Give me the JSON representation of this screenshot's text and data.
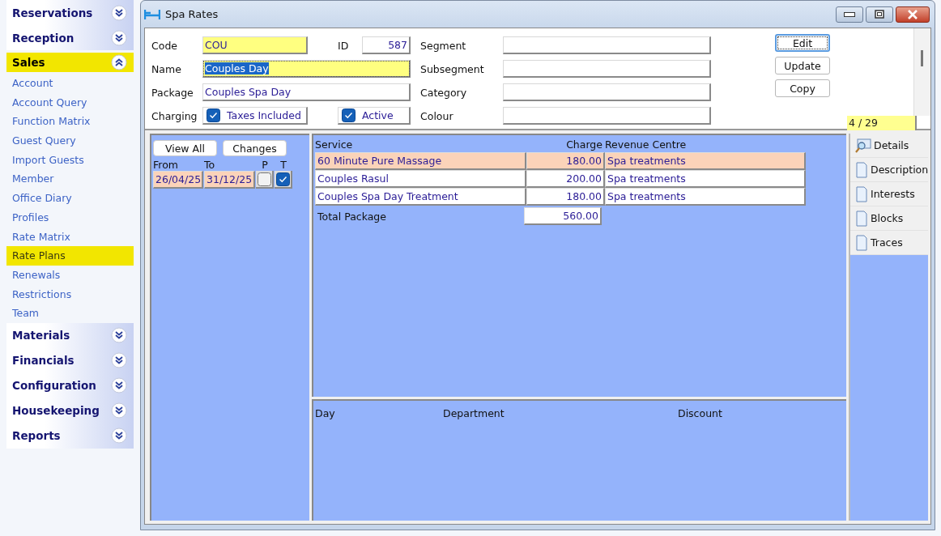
{
  "sidebar": {
    "sections": [
      {
        "label": "Reservations",
        "expanded": false,
        "selected": false
      },
      {
        "label": "Reception",
        "expanded": false,
        "selected": false
      },
      {
        "label": "Sales",
        "expanded": true,
        "selected": true,
        "items": [
          {
            "label": "Account",
            "selected": false
          },
          {
            "label": "Account Query",
            "selected": false
          },
          {
            "label": "Function Matrix",
            "selected": false
          },
          {
            "label": "Guest Query",
            "selected": false
          },
          {
            "label": "Import Guests",
            "selected": false
          },
          {
            "label": "Member",
            "selected": false
          },
          {
            "label": "Office Diary",
            "selected": false
          },
          {
            "label": "Profiles",
            "selected": false
          },
          {
            "label": "Rate Matrix",
            "selected": false
          },
          {
            "label": "Rate Plans",
            "selected": true
          },
          {
            "label": "Renewals",
            "selected": false
          },
          {
            "label": "Restrictions",
            "selected": false
          },
          {
            "label": "Team",
            "selected": false
          }
        ]
      },
      {
        "label": "Materials",
        "expanded": false,
        "selected": false
      },
      {
        "label": "Financials",
        "expanded": false,
        "selected": false
      },
      {
        "label": "Configuration",
        "expanded": false,
        "selected": false
      },
      {
        "label": "Housekeeping",
        "expanded": false,
        "selected": false
      },
      {
        "label": "Reports",
        "expanded": false,
        "selected": false
      }
    ]
  },
  "window": {
    "title": "Spa Rates"
  },
  "form": {
    "code": {
      "label": "Code",
      "value": "COU"
    },
    "id": {
      "label": "ID",
      "value": "587"
    },
    "name": {
      "label": "Name",
      "value": "Couples Day",
      "text_selected": true
    },
    "package": {
      "label": "Package",
      "value": "Couples Spa Day"
    },
    "charging": {
      "label": "Charging",
      "checkboxes": [
        {
          "label": "Taxes Included",
          "checked": true
        },
        {
          "label": "Active",
          "checked": true
        }
      ]
    },
    "segment": {
      "label": "Segment"
    },
    "subsegment": {
      "label": "Subsegment"
    },
    "category": {
      "label": "Category"
    },
    "colour": {
      "label": "Colour"
    },
    "buttons": [
      {
        "label": "Edit",
        "focused": true
      },
      {
        "label": "Update",
        "focused": false
      },
      {
        "label": "Copy",
        "focused": false
      }
    ],
    "record_counter": "4 / 29"
  },
  "periods": {
    "buttons": [
      "View All",
      "Changes"
    ],
    "columns": [
      "From",
      "To",
      "P",
      "T"
    ],
    "rows": [
      {
        "from": "26/04/25",
        "to": "31/12/25",
        "p": false,
        "t": true,
        "selected": true
      }
    ]
  },
  "services": {
    "columns": [
      "Service",
      "Charge",
      "Revenue Centre"
    ],
    "rows": [
      {
        "service": "60 Minute Pure Massage",
        "charge": "180.00",
        "revenue_centre": "Spa treatments",
        "selected": true
      },
      {
        "service": "Couples Rasul",
        "charge": "200.00",
        "revenue_centre": "Spa treatments",
        "selected": false
      },
      {
        "service": "Couples Spa Day Treatment",
        "charge": "180.00",
        "revenue_centre": "Spa treatments",
        "selected": false
      }
    ],
    "total": {
      "label": "Total Package",
      "value": "560.00"
    }
  },
  "discounts": {
    "columns": [
      "Day",
      "Department",
      "Discount"
    ]
  },
  "side_tabs": [
    {
      "label": "Details",
      "kind": "details"
    },
    {
      "label": "Description",
      "kind": "page"
    },
    {
      "label": "Interests",
      "kind": "page"
    },
    {
      "label": "Blocks",
      "kind": "page"
    },
    {
      "label": "Traces",
      "kind": "page"
    }
  ]
}
